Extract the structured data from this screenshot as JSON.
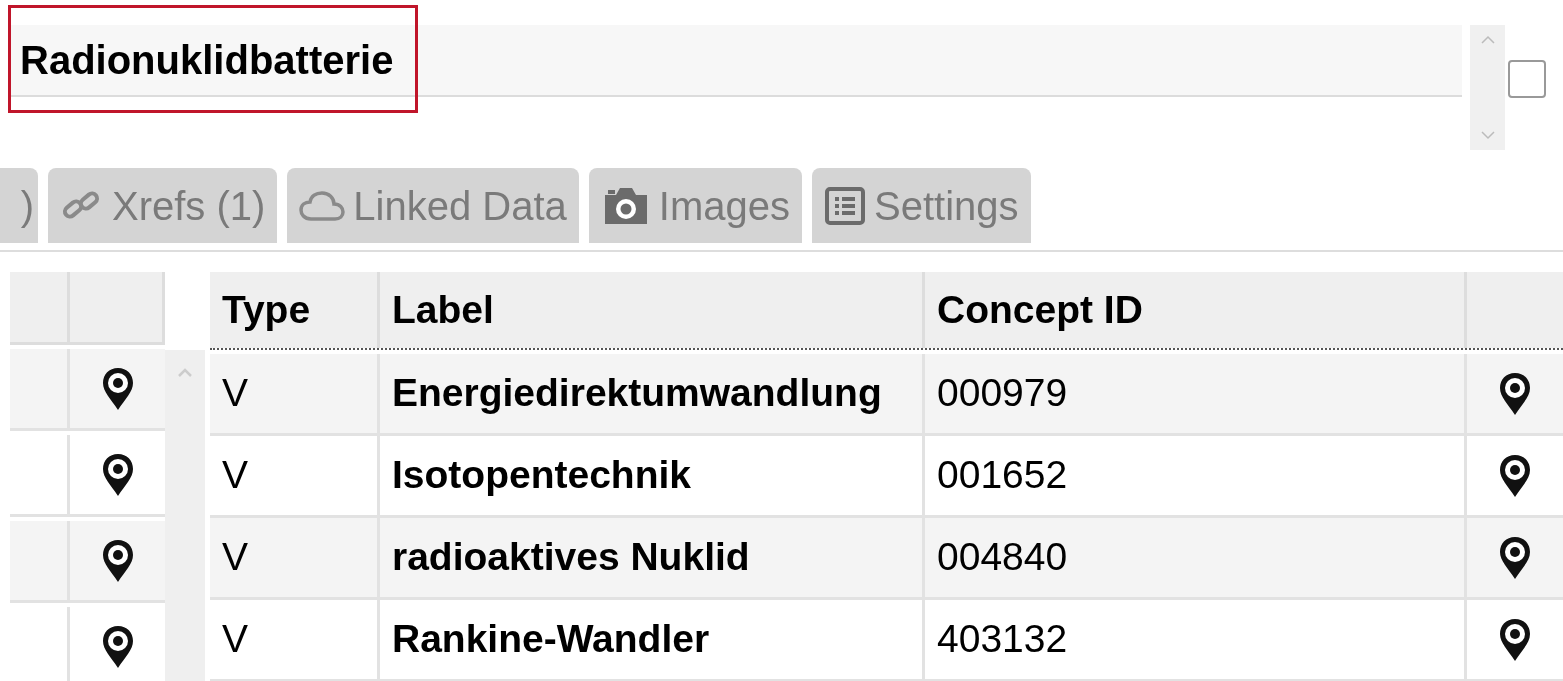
{
  "title_field": {
    "value": "Radionuklidbatterie",
    "highlighted": true
  },
  "checkbox": {
    "checked": false
  },
  "tabs": [
    {
      "label": ")",
      "kind": "cut"
    },
    {
      "label": "Xrefs (1)",
      "kind": "link"
    },
    {
      "label": "Linked Data",
      "kind": "cloud"
    },
    {
      "label": "Images",
      "kind": "camera"
    },
    {
      "label": "Settings",
      "kind": "list"
    }
  ],
  "table": {
    "columns": [
      "Type",
      "Label",
      "Concept ID"
    ],
    "rows": [
      {
        "type": "V",
        "label": "Energiedirektumwandlung",
        "concept_id": "000979"
      },
      {
        "type": "V",
        "label": "Isotopentechnik",
        "concept_id": "001652"
      },
      {
        "type": "V",
        "label": "radioaktives Nuklid",
        "concept_id": "004840"
      },
      {
        "type": "V",
        "label": "Rankine-Wandler",
        "concept_id": "403132"
      }
    ]
  }
}
